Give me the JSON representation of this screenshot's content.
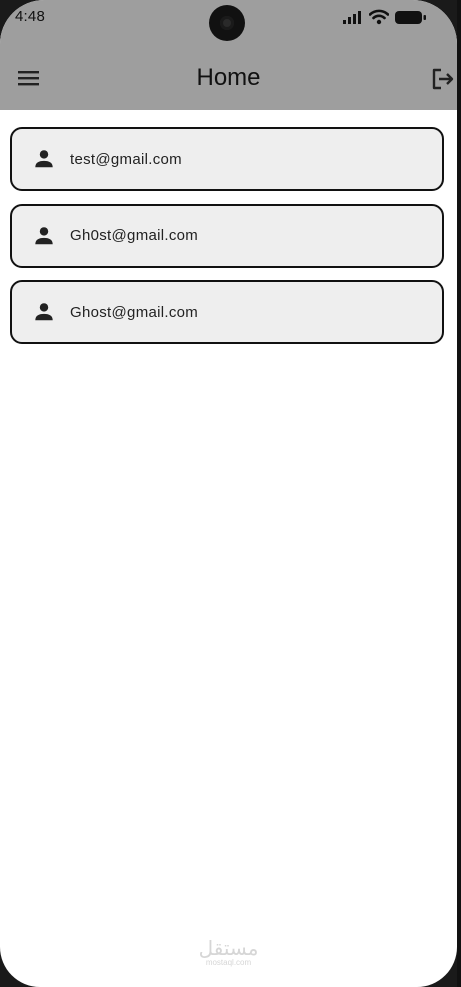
{
  "status_bar": {
    "time": "4:48",
    "icons": [
      "signal-icon",
      "wifi-icon",
      "battery-icon"
    ]
  },
  "app_bar": {
    "title": "Home",
    "menu_icon": "menu-icon",
    "logout_icon": "logout-icon"
  },
  "users": [
    {
      "email": "test@gmail.com",
      "icon": "person-icon"
    },
    {
      "email": "Gh0st@gmail.com",
      "icon": "person-icon"
    },
    {
      "email": "Ghost@gmail.com",
      "icon": "person-icon"
    }
  ],
  "watermark": {
    "main": "مستقل",
    "sub": "mostaql.com"
  },
  "colors": {
    "app_bar": "#9e9e9e",
    "card_bg": "#eeeeee",
    "card_border": "#111111",
    "background": "#ffffff"
  }
}
